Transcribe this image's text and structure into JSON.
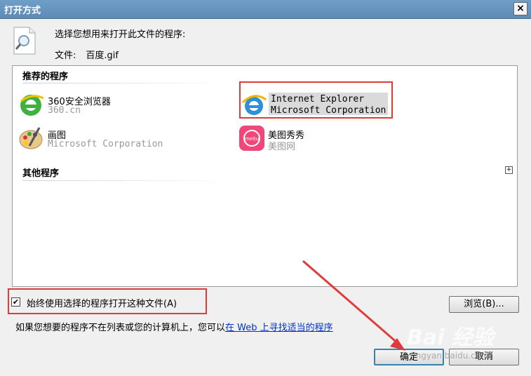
{
  "window": {
    "title": "打开方式",
    "close_label": "×"
  },
  "header": {
    "prompt": "选择您想用来打开此文件的程序:",
    "file_label": "文件:",
    "file_name": "百度.gif"
  },
  "recommended": {
    "heading": "推荐的程序",
    "programs": [
      {
        "name": "360安全浏览器",
        "publisher": "360.cn",
        "icon": "360-browser-icon"
      },
      {
        "name": "Internet Explorer",
        "publisher": "Microsoft Corporation",
        "icon": "internet-explorer-icon",
        "selected": true
      },
      {
        "name": "画图",
        "publisher": "Microsoft Corporation",
        "icon": "paint-icon"
      },
      {
        "name": "美图秀秀",
        "publisher": "美图网",
        "icon": "meitu-icon",
        "icon_text": "meitu"
      }
    ]
  },
  "other": {
    "heading": "其他程序",
    "expand_label": "+"
  },
  "always_use": {
    "label": "始终使用选择的程序打开这种文件(A)",
    "checked": true,
    "check_mark": "✔"
  },
  "browse_button": "浏览(B)...",
  "hint": {
    "text": "如果您想要的程序不在列表或您的计算机上，您可以",
    "link": "在 Web 上寻找适当的程序"
  },
  "ok_button": "确定",
  "cancel_button": "取消",
  "watermark": {
    "text": "Bai 经验",
    "sub": "jingyan.baidu.com"
  },
  "colors": {
    "titlebar": "#5d8ab6",
    "highlight": "#e03b3b",
    "link": "#0033cc"
  }
}
